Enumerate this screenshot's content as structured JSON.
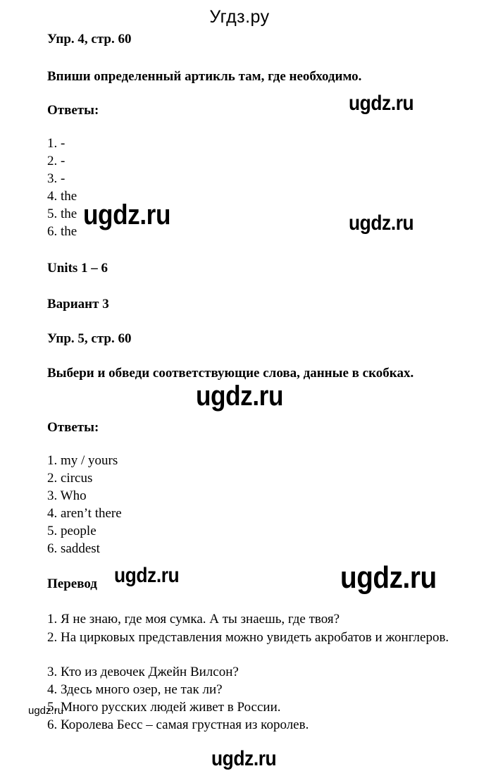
{
  "site_title": "Угдз.ру",
  "watermark": "ugdz.ru",
  "exercise1": {
    "heading": "Упр. 4, стр. 60",
    "instruction": "Впиши определенный артикль там, где необходимо.",
    "answers_label": "Ответы:",
    "answers": [
      "1. -",
      "2. -",
      "3. -",
      "4. the",
      "5. the",
      "6. the"
    ]
  },
  "units_heading": "Units 1 – 6",
  "variant_heading": "Вариант 3",
  "exercise2": {
    "heading": "Упр. 5, стр. 60",
    "instruction": "Выбери и обведи соответствующие слова, данные в скобках.",
    "answers_label": "Ответы:",
    "answers": [
      "1. my / yours",
      "2. circus",
      "3. Who",
      "4. aren’t there",
      "5. people",
      "6. saddest"
    ],
    "translation_label": "Перевод",
    "translation": [
      "1. Я не знаю, где моя сумка. А ты знаешь, где твоя?",
      "2. На цирковых представления можно увидеть акробатов и жонглеров.",
      "3. Кто из девочек Джейн Вилсон?",
      "4. Здесь много озер, не так ли?",
      "5. Много русских людей живет в России.",
      "6. Королева Бесс – самая грустная из королев."
    ]
  }
}
